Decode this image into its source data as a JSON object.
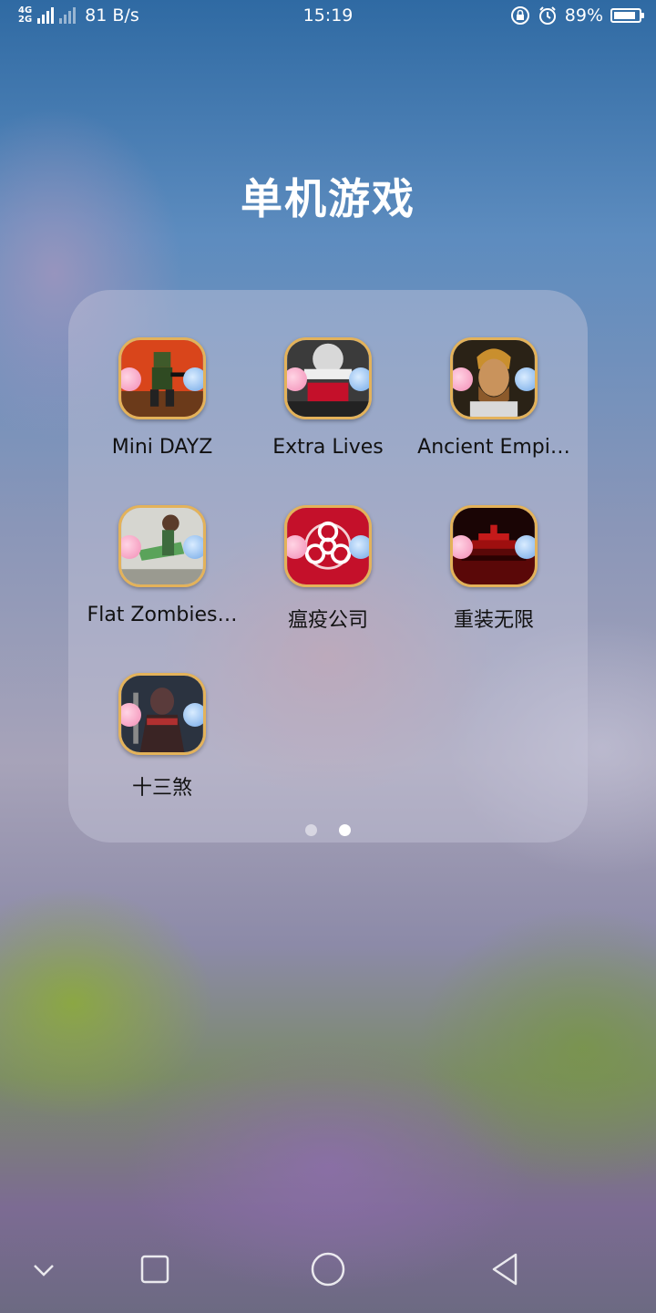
{
  "status_bar": {
    "network_top": "4G",
    "network_bottom": "2G",
    "speed": "81 B/s",
    "time": "15:19",
    "battery": "89%",
    "battery_level": 0.89
  },
  "folder": {
    "title": "单机游戏",
    "apps": [
      {
        "label": "Mini DAYZ",
        "icon": "mini-dayz-icon",
        "color": "#d9451b"
      },
      {
        "label": "Extra Lives",
        "icon": "extra-lives-icon",
        "color": "#3b3b3b"
      },
      {
        "label": "Ancient Empi…",
        "icon": "ancient-empires-icon",
        "color": "#8c5a2b"
      },
      {
        "label": "Flat Zombies…",
        "icon": "flat-zombies-icon",
        "color": "#5aa35a"
      },
      {
        "label": "瘟疫公司",
        "icon": "plague-inc-icon",
        "color": "#c4102a"
      },
      {
        "label": "重装无限",
        "icon": "heavy-armor-icon",
        "color": "#9e0f0f"
      },
      {
        "label": "十三煞",
        "icon": "thirteen-sha-icon",
        "color": "#5a3b3b"
      }
    ],
    "pages": 2,
    "current_page": 2
  },
  "nav_bar": {
    "icons": [
      "chevron-down-icon",
      "recent-apps-icon",
      "home-icon",
      "back-icon"
    ]
  }
}
